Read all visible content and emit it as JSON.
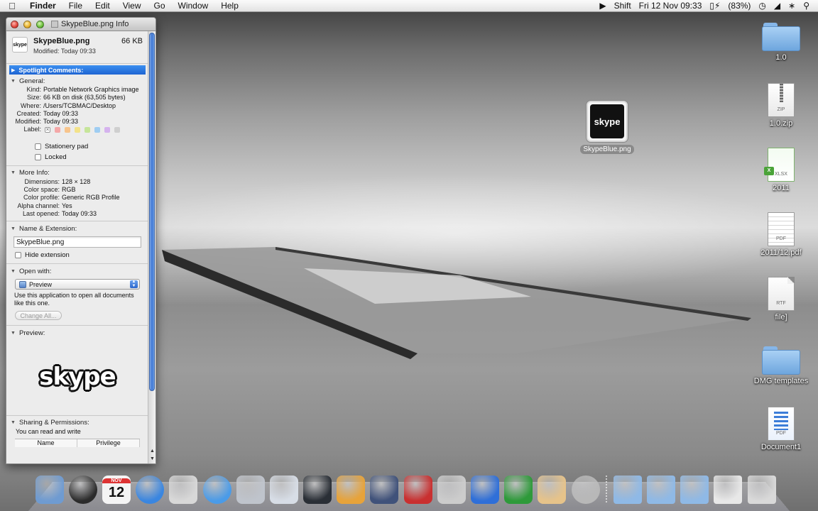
{
  "menubar": {
    "app_name": "Finder",
    "menus": [
      "File",
      "Edit",
      "View",
      "Go",
      "Window",
      "Help"
    ],
    "status": {
      "keystroke": "Shift",
      "datetime": "Fri 12 Nov  09:33",
      "battery": "(83%)"
    }
  },
  "info_window": {
    "title": "SkypeBlue.png Info",
    "file_name": "SkypeBlue.png",
    "file_size": "66 KB",
    "modified_summary": "Modified: Today 09:33",
    "icon_text": "skype",
    "spotlight_label": "Spotlight Comments:",
    "general": {
      "header": "General:",
      "rows": [
        {
          "k": "Kind:",
          "v": "Portable Network Graphics image"
        },
        {
          "k": "Size:",
          "v": "66 KB on disk (63,505 bytes)"
        },
        {
          "k": "Where:",
          "v": "/Users/TCBMAC/Desktop"
        },
        {
          "k": "Created:",
          "v": "Today 09:33"
        },
        {
          "k": "Modified:",
          "v": "Today 09:33"
        }
      ],
      "label_key": "Label:",
      "label_colors": [
        "#f4a8a8",
        "#f7c48c",
        "#f3e28a",
        "#c6e59a",
        "#9fcdf2",
        "#d5b3ee",
        "#cfcfcf"
      ],
      "stationery": "Stationery pad",
      "locked": "Locked"
    },
    "more_info": {
      "header": "More Info:",
      "rows": [
        {
          "k": "Dimensions:",
          "v": "128 × 128"
        },
        {
          "k": "Color space:",
          "v": "RGB"
        },
        {
          "k": "Color profile:",
          "v": "Generic RGB Profile"
        },
        {
          "k": "Alpha channel:",
          "v": "Yes"
        },
        {
          "k": "Last opened:",
          "v": "Today 09:33"
        }
      ]
    },
    "name_ext": {
      "header": "Name & Extension:",
      "value": "SkypeBlue.png",
      "hide_extension": "Hide extension"
    },
    "open_with": {
      "header": "Open with:",
      "app": "Preview",
      "note": "Use this application to open all documents like this one.",
      "change_all": "Change All..."
    },
    "preview": {
      "header": "Preview:",
      "logo_text": "skype"
    },
    "sharing": {
      "header": "Sharing & Permissions:",
      "text": "You can read and write",
      "columns": [
        "Name",
        "Privilege"
      ]
    }
  },
  "desktop": {
    "dragged_file": {
      "label": "SkypeBlue.png",
      "logo": "skype"
    },
    "icons": [
      {
        "label": "1.0",
        "type": "folder"
      },
      {
        "label": "1.0.zip",
        "type": "zip",
        "tag": "ZIP"
      },
      {
        "label": "2011",
        "type": "xlsx",
        "tag": "XLSX"
      },
      {
        "label": "2011/12.pdf",
        "type": "pdf",
        "tag": "PDF"
      },
      {
        "label": "file]",
        "type": "rtf",
        "tag": "RTF"
      },
      {
        "label": "DMG templates",
        "type": "folder"
      },
      {
        "label": "Document1",
        "type": "pdf-blue",
        "tag": "PDF"
      }
    ]
  },
  "dock": {
    "calendar_month": "NOV",
    "calendar_day": "12",
    "items": [
      {
        "name": "finder",
        "color": "#6f9bd1"
      },
      {
        "name": "dashboard",
        "color": "#2b2b2b"
      },
      {
        "name": "ical",
        "color": "#f2f2f2"
      },
      {
        "name": "quicktime",
        "color": "#3a86e0"
      },
      {
        "name": "user-app",
        "color": "#d8d8d8"
      },
      {
        "name": "safari",
        "color": "#4a9be8"
      },
      {
        "name": "calculator",
        "color": "#bfc4cc"
      },
      {
        "name": "eagle-app",
        "color": "#d7dde6"
      },
      {
        "name": "activity-monitor",
        "color": "#2a2f36"
      },
      {
        "name": "paint-app",
        "color": "#e7a33a"
      },
      {
        "name": "aircraft-app",
        "color": "#40527a"
      },
      {
        "name": "stamp-app",
        "color": "#c93030"
      },
      {
        "name": "spotlight-app",
        "color": "#cccccc"
      },
      {
        "name": "word",
        "color": "#2f6fd8"
      },
      {
        "name": "excel",
        "color": "#2e9a3a"
      },
      {
        "name": "people-app",
        "color": "#e6c38a"
      },
      {
        "name": "recorder-app",
        "color": "#b8b8b8"
      }
    ],
    "stack_items": [
      {
        "name": "applications-stack",
        "color": "#8fb9e6"
      },
      {
        "name": "documents-stack",
        "color": "#8fb9e6"
      },
      {
        "name": "downloads-stack",
        "color": "#8fb9e6"
      },
      {
        "name": "screenshots-stack",
        "color": "#e8e8e8"
      },
      {
        "name": "trash",
        "color": "#d9d9d9"
      }
    ]
  }
}
